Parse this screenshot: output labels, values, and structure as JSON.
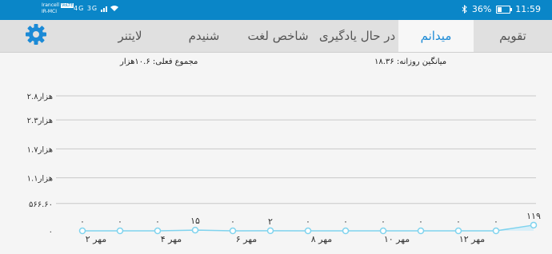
{
  "status_bar": {
    "carrier_line1": "Irancell",
    "carrier_badge": "VoLTE",
    "carrier_line2": "IR-MCI",
    "signal_text": "4G 3G",
    "battery_text": "36%",
    "battery_level": 0.36,
    "time": "11:59",
    "icons": [
      "bluetooth-icon",
      "battery-icon",
      "wifi-icon",
      "cellular-signal-icon"
    ]
  },
  "tabs": [
    {
      "label": "تقویم",
      "active": false
    },
    {
      "label": "میدانم",
      "active": true
    },
    {
      "label": "در حال یادگیری",
      "active": false
    },
    {
      "label": "شاخص لغت",
      "active": false
    },
    {
      "label": "شنیدم",
      "active": false
    },
    {
      "label": "لایتنر",
      "active": false
    }
  ],
  "settings_icon": "gear-icon",
  "colors": {
    "accent": "#1b8ad6",
    "statusbar": "#0a86c8",
    "tabbar": "#e0e0e0",
    "line": "#7fd3ee"
  },
  "stats": {
    "daily_average": "میانگین روزانه: ۱۸.۳۶",
    "current_total": "مجموع فعلی: ۱۰.۶هزار"
  },
  "chart_data": {
    "type": "area",
    "title": "",
    "xlabel": "",
    "ylabel": "",
    "ylim": [
      0,
      2800
    ],
    "y_ticks": [
      {
        "value": 0,
        "label": "۰"
      },
      {
        "value": 566.6,
        "label": "۵۶۶.۶۰"
      },
      {
        "value": 1100,
        "label": "۱.۱هزار"
      },
      {
        "value": 1700,
        "label": "۱.۷هزار"
      },
      {
        "value": 2300,
        "label": "۲.۳هزار"
      },
      {
        "value": 2800,
        "label": "۲.۸هزار"
      }
    ],
    "x_ticks": [
      {
        "index": 1,
        "label": "۲ مهر"
      },
      {
        "index": 3,
        "label": "۴ مهر"
      },
      {
        "index": 5,
        "label": "۶ مهر"
      },
      {
        "index": 7,
        "label": "۸ مهر"
      },
      {
        "index": 9,
        "label": "۱۰ مهر"
      },
      {
        "index": 11,
        "label": "۱۲ مهر"
      }
    ],
    "values": [
      0,
      0,
      0,
      15,
      0,
      2,
      0,
      0,
      0,
      0,
      0,
      0,
      119
    ],
    "value_labels": [
      "۰",
      "۰",
      "۰",
      "۱۵",
      "۰",
      "۲",
      "۰",
      "۰",
      "۰",
      "۰",
      "۰",
      "۰",
      "۱۱۹"
    ],
    "grid": true,
    "legend": "none"
  }
}
